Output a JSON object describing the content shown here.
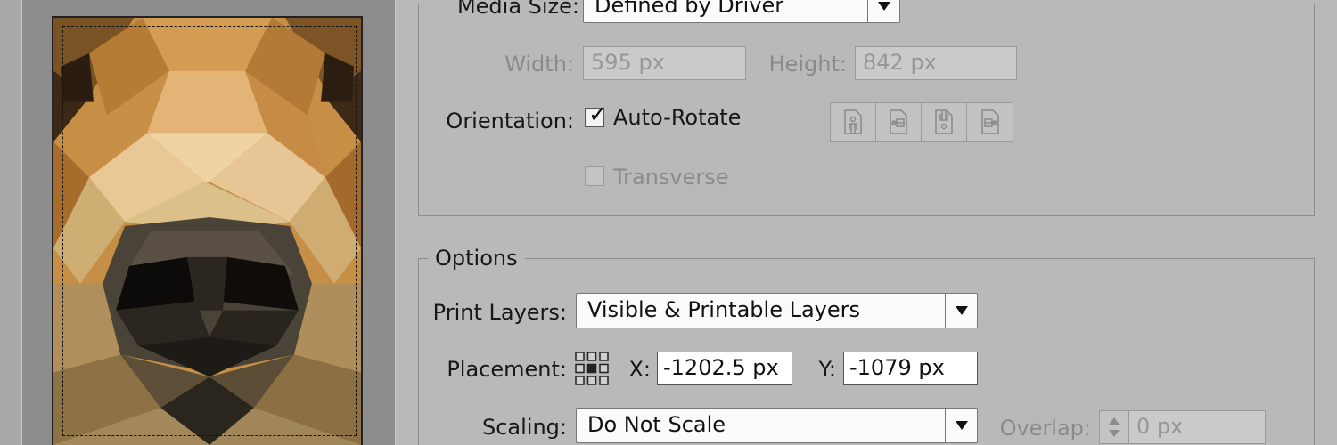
{
  "media": {
    "size_label": "Media Size:",
    "size_value": "Defined by Driver",
    "width_label": "Width:",
    "width_value": "595 px",
    "height_label": "Height:",
    "height_value": "842 px",
    "orientation_label": "Orientation:",
    "auto_rotate_label": "Auto-Rotate",
    "auto_rotate_checked": true,
    "transverse_label": "Transverse",
    "transverse_checked": false,
    "orientation_buttons": [
      "portrait-icon",
      "landscape-icon",
      "reverse-portrait-icon",
      "reverse-landscape-icon"
    ]
  },
  "options": {
    "legend": "Options",
    "print_layers_label": "Print Layers:",
    "print_layers_value": "Visible & Printable Layers",
    "placement_label": "Placement:",
    "x_label": "X:",
    "x_value": "-1202.5 px",
    "y_label": "Y:",
    "y_value": "-1079 px",
    "scaling_label": "Scaling:",
    "scaling_value": "Do Not Scale",
    "overlap_label": "Overlap:",
    "overlap_value": "0 px"
  },
  "colors": {
    "dialog_bg": "#b9b9b9",
    "preview_bg": "#8d8d8d",
    "disabled_text": "#8a8a8a"
  }
}
